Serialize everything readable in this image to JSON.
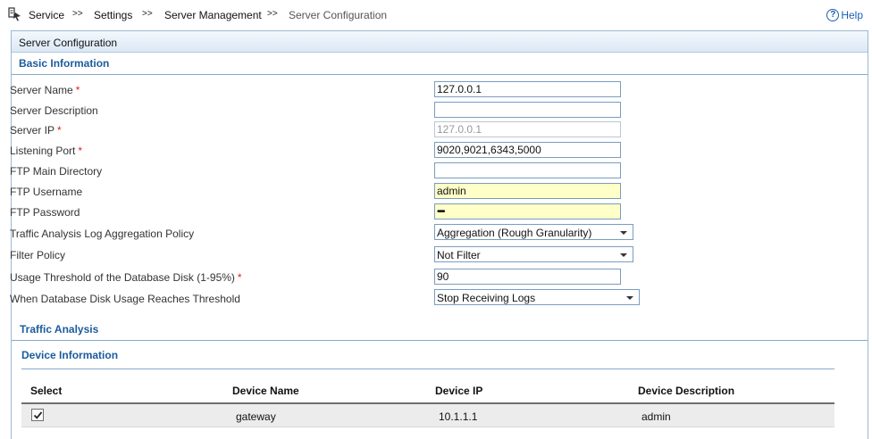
{
  "breadcrumb": {
    "items": [
      "Service",
      "Settings",
      "Server Management",
      "Server Configuration"
    ],
    "separator": ">>"
  },
  "help": {
    "label": "Help",
    "icon": "help-icon"
  },
  "panel": {
    "title": "Server Configuration",
    "basic_info_title": "Basic Information",
    "traffic_analysis_title": "Traffic Analysis",
    "device_info_title": "Device Information"
  },
  "form": {
    "server_name_label": "Server Name",
    "server_name_value": "127.0.0.1",
    "server_description_label": "Server Description",
    "server_description_value": "",
    "server_ip_label": "Server IP",
    "server_ip_value": "127.0.0.1",
    "listening_port_label": "Listening Port",
    "listening_port_value": "9020,9021,6343,5000",
    "ftp_main_dir_label": "FTP Main Directory",
    "ftp_main_dir_value": "",
    "ftp_username_label": "FTP Username",
    "ftp_username_value": "admin",
    "ftp_password_label": "FTP Password",
    "ftp_password_value": "•••••",
    "log_aggregation_label": "Traffic Analysis Log Aggregation Policy",
    "log_aggregation_value": "Aggregation (Rough Granularity)",
    "filter_policy_label": "Filter Policy",
    "filter_policy_value": "Not Filter",
    "disk_threshold_label": "Usage Threshold of the Database Disk (1-95%)",
    "disk_threshold_value": "90",
    "threshold_action_label": "When Database Disk Usage Reaches Threshold",
    "threshold_action_value": "Stop Receiving Logs",
    "required_mark": "*"
  },
  "device_table": {
    "columns": [
      "Select",
      "Device Name",
      "Device IP",
      "Device Description"
    ],
    "rows": [
      {
        "selected": true,
        "name": "gateway",
        "ip": "10.1.1.1",
        "description": "admin"
      }
    ]
  },
  "colors": {
    "section_title": "#1b5b9c",
    "required": "#e02020",
    "highlight_field": "#ffffc8",
    "help": "#1a5fb4"
  }
}
